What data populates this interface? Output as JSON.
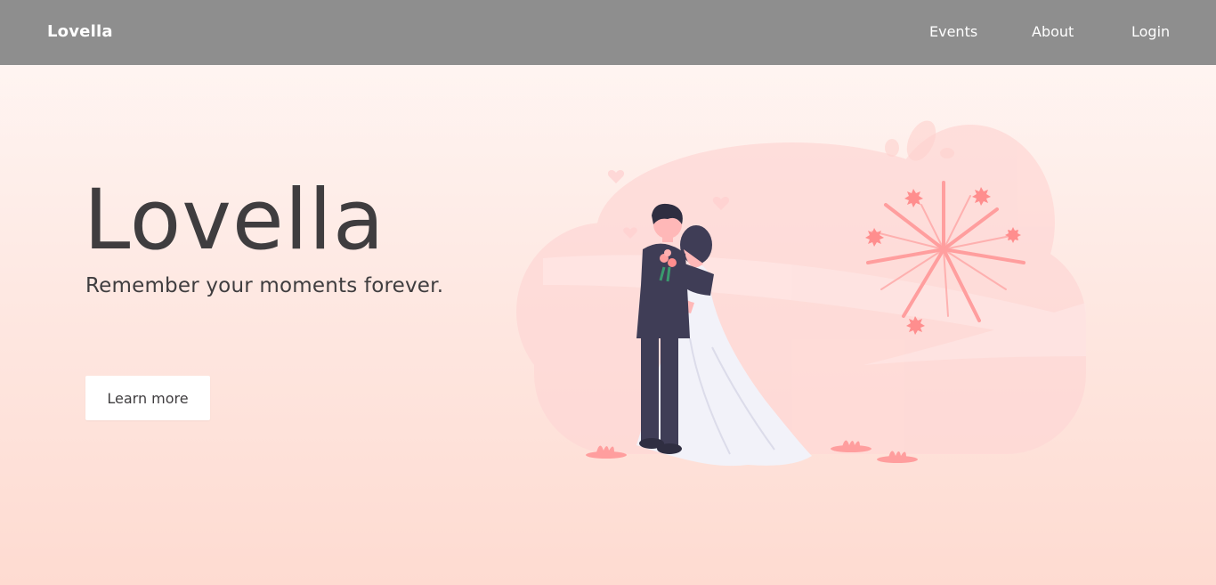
{
  "navbar": {
    "brand": "Lovella",
    "links": [
      "Events",
      "About",
      "Login"
    ]
  },
  "hero": {
    "title": "Lovella",
    "subtitle": "Remember your moments forever.",
    "cta_label": "Learn more"
  },
  "colors": {
    "navbar_bg": "#8e8e8e",
    "text_dark": "#3f3d3f",
    "accent_pink": "#ff9e9e",
    "suit": "#3f3d56"
  },
  "illustration": {
    "icon": "wedding-couple-fireworks-icon"
  }
}
